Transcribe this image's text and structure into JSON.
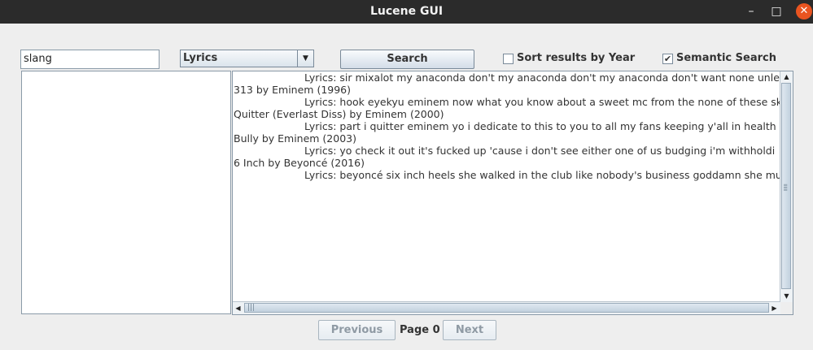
{
  "window": {
    "title": "Lucene GUI",
    "controls": {
      "minimize": "–",
      "maximize": "□",
      "close": "✕"
    }
  },
  "search": {
    "query": "slang"
  },
  "field_select": {
    "selected": "Lyrics"
  },
  "buttons": {
    "search": "Search",
    "previous": "Previous",
    "next": "Next"
  },
  "options": {
    "sort_by_year": {
      "label": "Sort results by Year",
      "checked": false
    },
    "semantic_search": {
      "label": "Semantic Search",
      "checked": true
    }
  },
  "results": {
    "lines": [
      "Lyrics: sir mixalot my anaconda don't my anaconda don't my anaconda don't want none unles",
      "313 by Eminem (1996)",
      "Lyrics: hook eyekyu  eminem now what you know about a sweet mc from the  none of these sk",
      "Quitter (Everlast Diss) by Eminem (2000)",
      "Lyrics: part i quitter    eminem yo i dedicate to this to you to all my fans keeping y'all in health",
      "Bully by Eminem (2003)",
      "Lyrics: yo check it out it's fucked up 'cause i don't see either one of us budging   i'm withholdi",
      "6 Inch by Beyoncé (2016)",
      "Lyrics: beyoncé six inch heels she walked in the club like nobody's business goddamn she mu"
    ]
  },
  "pagination": {
    "label": "Page 0"
  }
}
